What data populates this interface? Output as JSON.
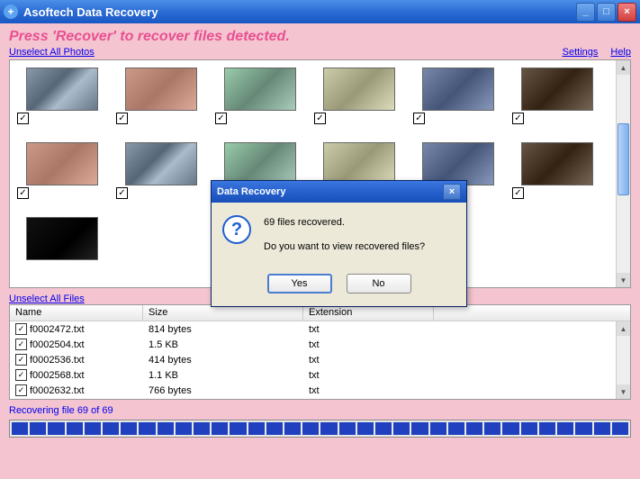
{
  "titlebar": {
    "app_name": "Asoftech Data Recovery"
  },
  "instruction": "Press 'Recover' to recover files detected.",
  "links": {
    "unselect_photos": "Unselect All Photos",
    "unselect_files": "Unselect All Files",
    "settings": "Settings",
    "help": "Help"
  },
  "file_table": {
    "headers": {
      "name": "Name",
      "size": "Size",
      "ext": "Extension"
    },
    "rows": [
      {
        "name": "f0002472.txt",
        "size": "814 bytes",
        "ext": "txt",
        "checked": true
      },
      {
        "name": "f0002504.txt",
        "size": "1.5 KB",
        "ext": "txt",
        "checked": true
      },
      {
        "name": "f0002536.txt",
        "size": "414 bytes",
        "ext": "txt",
        "checked": true
      },
      {
        "name": "f0002568.txt",
        "size": "1.1 KB",
        "ext": "txt",
        "checked": true
      },
      {
        "name": "f0002632.txt",
        "size": "766 bytes",
        "ext": "txt",
        "checked": true
      }
    ]
  },
  "progress": {
    "text": "Recovering file 69 of 69",
    "segments": 34
  },
  "dialog": {
    "title": "Data Recovery",
    "line1": "69 files recovered.",
    "line2": "Do you want to view recovered files?",
    "yes": "Yes",
    "no": "No"
  }
}
